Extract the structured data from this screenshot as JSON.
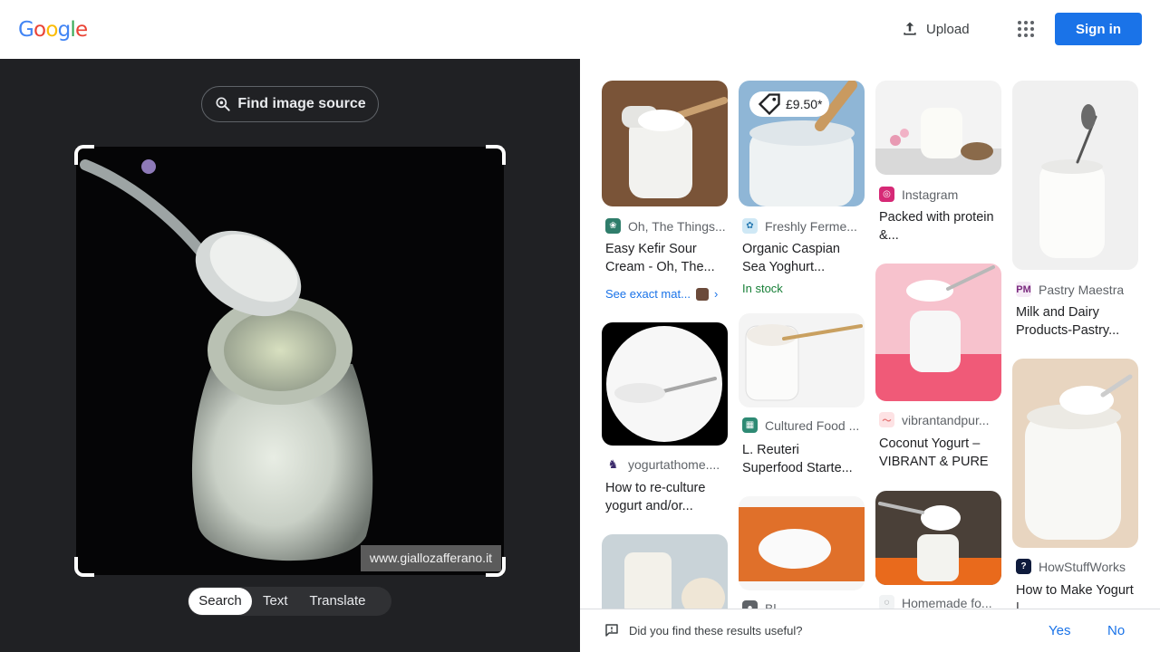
{
  "header": {
    "logo_letters": [
      {
        "char": "G",
        "color": "#4285F4"
      },
      {
        "char": "o",
        "color": "#EA4335"
      },
      {
        "char": "o",
        "color": "#FBBC05"
      },
      {
        "char": "g",
        "color": "#4285F4"
      },
      {
        "char": "l",
        "color": "#34A853"
      },
      {
        "char": "e",
        "color": "#EA4335"
      }
    ],
    "upload_label": "Upload",
    "apps_icon": "apps-grid-icon",
    "signin_label": "Sign in",
    "accent": "#1a73e8"
  },
  "lens": {
    "find_source_label": "Find image source",
    "watermark": "www.giallozafferano.it",
    "modes": [
      "Search",
      "Text",
      "Translate"
    ],
    "active_mode": "Search"
  },
  "results": [
    {
      "source": "Oh, The Things...",
      "title": "Easy Kefir Sour Cream - Oh, The...",
      "exact_match": "See exact mat..."
    },
    {
      "source": "Freshly Ferme...",
      "title": "Organic Caspian Sea Yoghurt...",
      "price": "£9.50*",
      "stock": "In stock"
    },
    {
      "source": "Instagram",
      "title": "Packed with protein &..."
    },
    {
      "source": "Pastry Maestra",
      "title": "Milk and Dairy Products-Pastry..."
    },
    {
      "source": "yogurtathome....",
      "title": "How to re-culture yogurt and/or..."
    },
    {
      "source": "Cultured Food ...",
      "title": "L. Reuteri Superfood Starte..."
    },
    {
      "source": "vibrantandpur...",
      "title": "Coconut Yogurt – VIBRANT & PURE"
    },
    {
      "source": "HowStuffWorks",
      "title": "How to Make Yogurt |..."
    },
    {
      "source": "Bl...",
      "title": ""
    },
    {
      "source": "Homemade fo...",
      "title": ""
    }
  ],
  "feedback": {
    "question": "Did you find these results useful?",
    "yes": "Yes",
    "no": "No"
  }
}
